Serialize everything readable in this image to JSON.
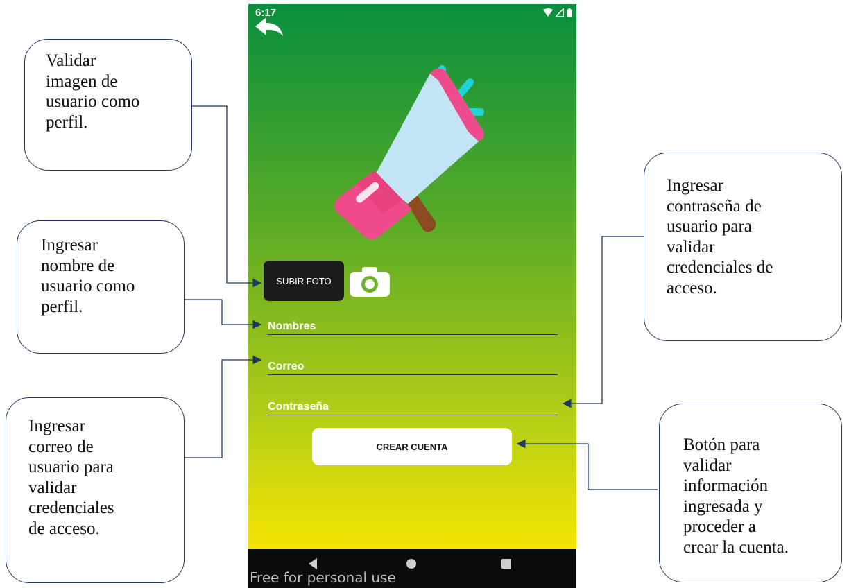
{
  "phone": {
    "status_time": "6:17",
    "upload_button": "SUBIR FOTO",
    "fields": {
      "nombres": "Nombres",
      "correo": "Correo",
      "contrasena": "Contraseña"
    },
    "create_button": "CREAR CUENTA",
    "watermark": "Free for personal use",
    "icons": [
      "back-arrow-icon",
      "megaphone-icon",
      "camera-icon",
      "wifi-icon",
      "signal-icon",
      "battery-icon"
    ],
    "colors": {
      "gradient_top": "#0a8f3e",
      "gradient_bottom": "#f6e402",
      "upload_bg": "#1c1c1c"
    }
  },
  "callouts": {
    "photo": "Validar\nimagen      de\nusuario como\nperfil.",
    "name": "Ingresar\nnombre      de\nusuario como\nperfil.",
    "email": "Ingresar\ncorreo         de\nusuario      para\nvalidar\ncredenciales\nde acceso.",
    "password": "Ingresar\ncontraseña      de\nusuario          para\nvalidar\ncredenciales de\nacceso.",
    "button": "Botón          para\nvalidar\ninformación\ningresada          y\nproceder          a\ncrear la cuenta."
  }
}
